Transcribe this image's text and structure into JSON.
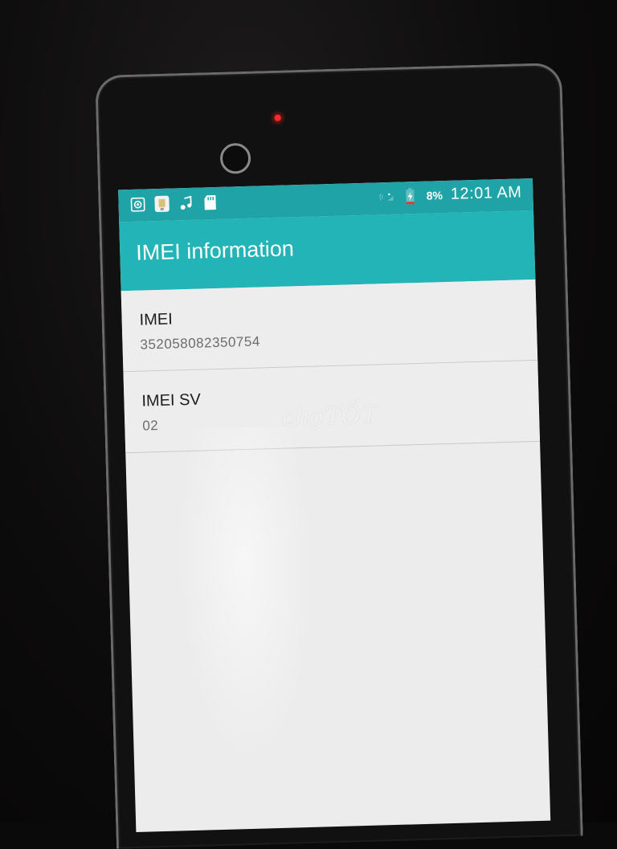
{
  "status_bar": {
    "left_icons": [
      "settings-icon",
      "sim-toolkit-icon",
      "music-icon",
      "sd-card-icon"
    ],
    "right_icons": [
      "no-signal-icon",
      "charging-icon"
    ],
    "battery_percent": "8%",
    "time": "12:01 AM"
  },
  "app_bar": {
    "title": "IMEI information"
  },
  "list": {
    "items": [
      {
        "label": "IMEI",
        "value": "352058082350754"
      },
      {
        "label": "IMEI SV",
        "value": "02"
      }
    ]
  },
  "watermark": "chợTỐT",
  "colors": {
    "status_bar": "#1fa3a6",
    "app_bar": "#22b4b6",
    "background": "#ededed",
    "camera_led": "#ff2b2b"
  }
}
